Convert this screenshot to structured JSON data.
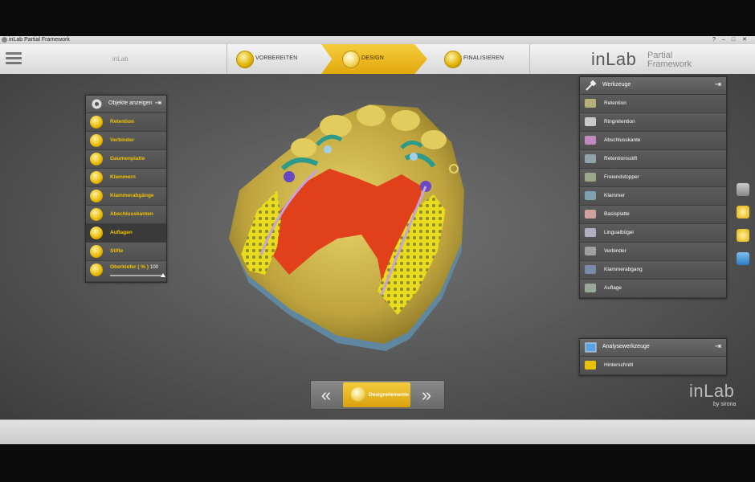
{
  "window": {
    "title": "inLab Partial Framework",
    "buttons": [
      "?",
      "–",
      "□",
      "✕"
    ]
  },
  "header": {
    "left_label": "inLab"
  },
  "steps": [
    {
      "label": "VORBEREITEN",
      "active": false
    },
    {
      "label": "DESIGN",
      "active": true
    },
    {
      "label": "FINALISIEREN",
      "active": false
    }
  ],
  "logo": {
    "brand": "inLab",
    "line1": "Partial",
    "line2": "Framework"
  },
  "left_panel": {
    "header": "Objekte anzeigen",
    "items": [
      {
        "label": "Retention",
        "icon": "retention-icon"
      },
      {
        "label": "Verbinder",
        "icon": "verbinder-icon"
      },
      {
        "label": "Gaumenplatte",
        "icon": "gaumenplatte-icon"
      },
      {
        "label": "Klammern",
        "icon": "klammern-icon"
      },
      {
        "label": "Klammerabgänge",
        "icon": "klammerabgaenge-icon"
      },
      {
        "label": "Abschlusskanten",
        "icon": "abschlusskanten-icon"
      },
      {
        "label": "Auflagen",
        "icon": "auflagen-icon",
        "selected": true
      },
      {
        "label": "Stifte",
        "icon": "stifte-icon"
      }
    ],
    "slider": {
      "label": "Oberkiefer ( % )",
      "value": "100",
      "level": 1.0
    }
  },
  "tools_panel": {
    "header": "Werkzeuge",
    "items": [
      {
        "label": "Retention",
        "color": "#b6b07a"
      },
      {
        "label": "Ringretention",
        "color": "#c9c9c9"
      },
      {
        "label": "Abschlusskante",
        "color": "#c08ac0"
      },
      {
        "label": "Retentionsstift",
        "color": "#8fa3a8"
      },
      {
        "label": "Freiendstopper",
        "color": "#9aa88a"
      },
      {
        "label": "Klammer",
        "color": "#7fa0b0"
      },
      {
        "label": "Basisplatte",
        "color": "#d0a0a0"
      },
      {
        "label": "Lingualbügel",
        "color": "#b0b0c0"
      },
      {
        "label": "Verbinder",
        "color": "#a0a0a0"
      },
      {
        "label": "Klammerabgang",
        "color": "#7a8aa8"
      },
      {
        "label": "Auflage",
        "color": "#9aa89a"
      }
    ]
  },
  "analysis_panel": {
    "header": "Analysewerkzeuge",
    "items": [
      {
        "label": "Hinterschnitt"
      }
    ]
  },
  "nav": {
    "center_label": "Designelemente",
    "prev": "«",
    "next": "»"
  },
  "brand": {
    "name": "inLab",
    "by": "by sirona"
  },
  "colors": {
    "accent": "#f2c200",
    "panel": "#535353"
  }
}
